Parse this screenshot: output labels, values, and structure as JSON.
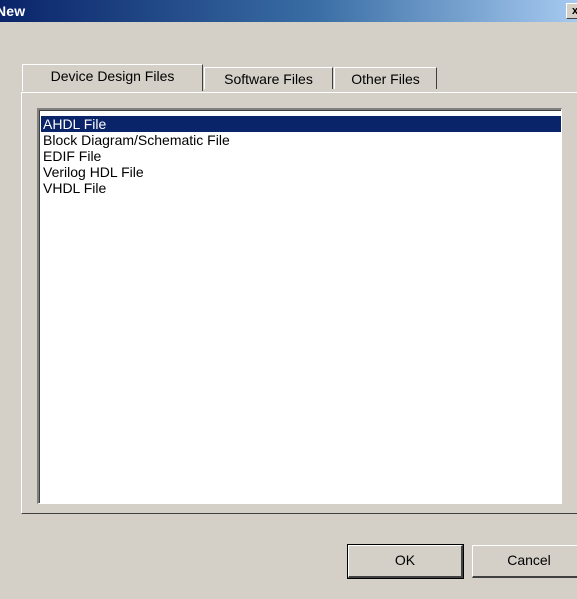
{
  "window": {
    "title": "New",
    "close_glyph": "x"
  },
  "tabs": [
    {
      "label": "Device Design Files",
      "active": true
    },
    {
      "label": "Software Files",
      "active": false
    },
    {
      "label": "Other Files",
      "active": false
    }
  ],
  "file_list": {
    "items": [
      {
        "label": "AHDL File",
        "selected": true
      },
      {
        "label": "Block Diagram/Schematic File",
        "selected": false
      },
      {
        "label": "EDIF File",
        "selected": false
      },
      {
        "label": "Verilog HDL File",
        "selected": false
      },
      {
        "label": "VHDL File",
        "selected": false
      }
    ]
  },
  "buttons": {
    "ok_label": "OK",
    "cancel_label": "Cancel"
  },
  "colors": {
    "title_bar": "#0a246a",
    "selection": "#0a246a",
    "dialog_face": "#d4d0c8"
  },
  "icons": {
    "close": "close-icon"
  }
}
